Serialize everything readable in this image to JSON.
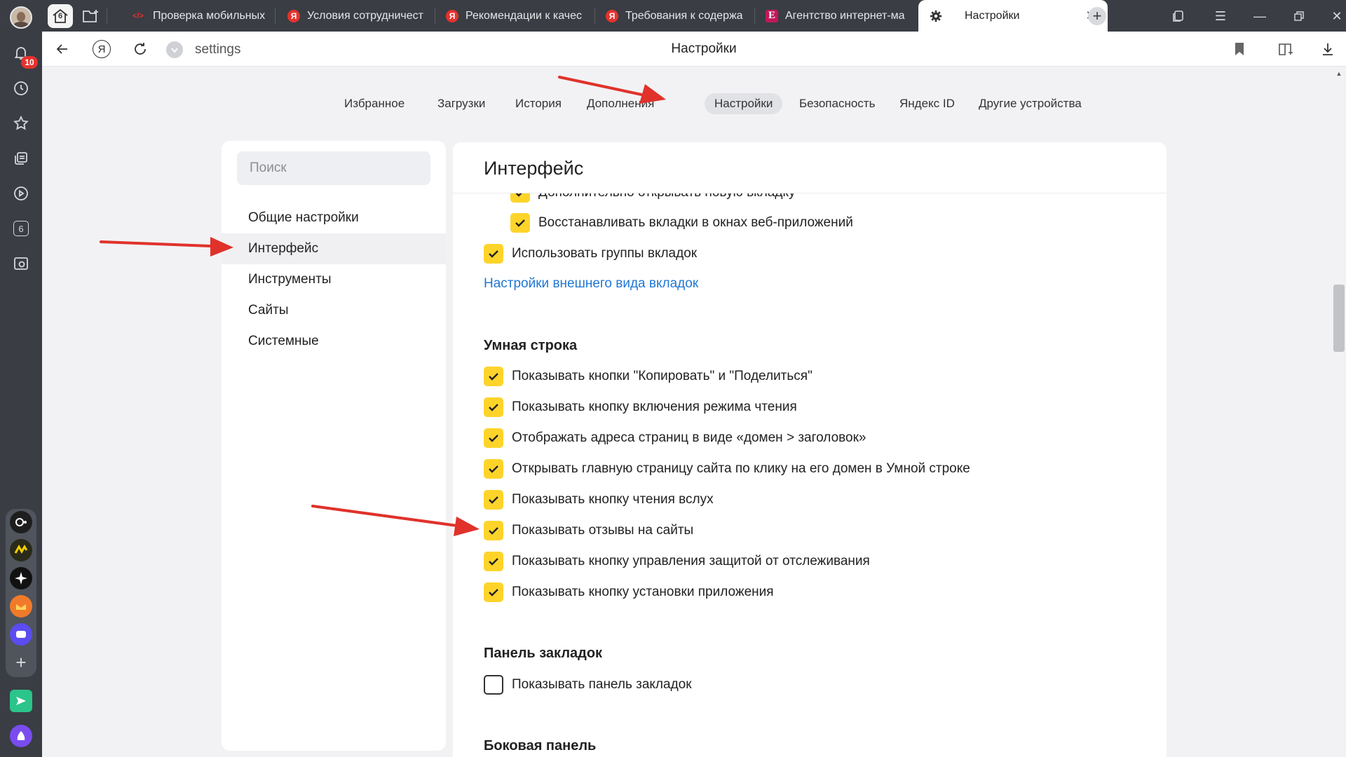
{
  "leftbar": {
    "notification_count": "10",
    "tab_count": "6"
  },
  "tabs": {
    "home_count": "6",
    "items": [
      {
        "title": "Проверка мобильных"
      },
      {
        "title": "Условия сотрудничест"
      },
      {
        "title": "Рекомендации к качес"
      },
      {
        "title": "Требования к содержа"
      },
      {
        "title": "Агентство интернет-ма"
      },
      {
        "title": "Настройки"
      }
    ],
    "favicon_letters": {
      "yandex": "Я",
      "agency": "E",
      "code": "</>"
    }
  },
  "addressbar": {
    "url": "settings",
    "page_title": "Настройки",
    "yandex_letter": "Я"
  },
  "topnav": {
    "items": [
      {
        "label": "Избранное"
      },
      {
        "label": "Загрузки"
      },
      {
        "label": "История"
      },
      {
        "label": "Дополнения"
      },
      {
        "label": "Настройки"
      },
      {
        "label": "Безопасность"
      },
      {
        "label": "Яндекс ID"
      },
      {
        "label": "Другие устройства"
      }
    ],
    "active": "Настройки"
  },
  "sidebar": {
    "search_placeholder": "Поиск",
    "items": [
      {
        "label": "Общие настройки"
      },
      {
        "label": "Интерфейс"
      },
      {
        "label": "Инструменты"
      },
      {
        "label": "Сайты"
      },
      {
        "label": "Системные"
      }
    ],
    "active": "Интерфейс"
  },
  "content": {
    "title": "Интерфейс",
    "tabs_options": [
      {
        "label": "Дополнительно открывать новую вкладку",
        "checked": true
      },
      {
        "label": "Восстанавливать вкладки в окнах веб-приложений",
        "checked": true
      },
      {
        "label": "Использовать группы вкладок",
        "checked": true
      }
    ],
    "tabs_link": "Настройки внешнего вида вкладок",
    "smart_bar": {
      "title": "Умная строка",
      "options": [
        {
          "label": "Показывать кнопки \"Копировать\" и \"Поделиться\"",
          "checked": true
        },
        {
          "label": "Показывать кнопку включения режима чтения",
          "checked": true
        },
        {
          "label": "Отображать адреса страниц в виде «домен > заголовок»",
          "checked": true
        },
        {
          "label": "Открывать главную страницу сайта по клику на его домен в Умной строке",
          "checked": true
        },
        {
          "label": "Показывать кнопку чтения вслух",
          "checked": true
        },
        {
          "label": "Показывать отзывы на сайты",
          "checked": true
        },
        {
          "label": "Показывать кнопку управления защитой от отслеживания",
          "checked": true
        },
        {
          "label": "Показывать кнопку установки приложения",
          "checked": true
        }
      ]
    },
    "bookmarks_bar": {
      "title": "Панель закладок",
      "options": [
        {
          "label": "Показывать панель закладок",
          "checked": false
        }
      ]
    },
    "side_panel": {
      "title": "Боковая панель"
    }
  },
  "colors": {
    "checkbox": "#fed42b",
    "link": "#1f77d3",
    "arrow": "#e0322b",
    "chrome": "#3a3d44"
  }
}
